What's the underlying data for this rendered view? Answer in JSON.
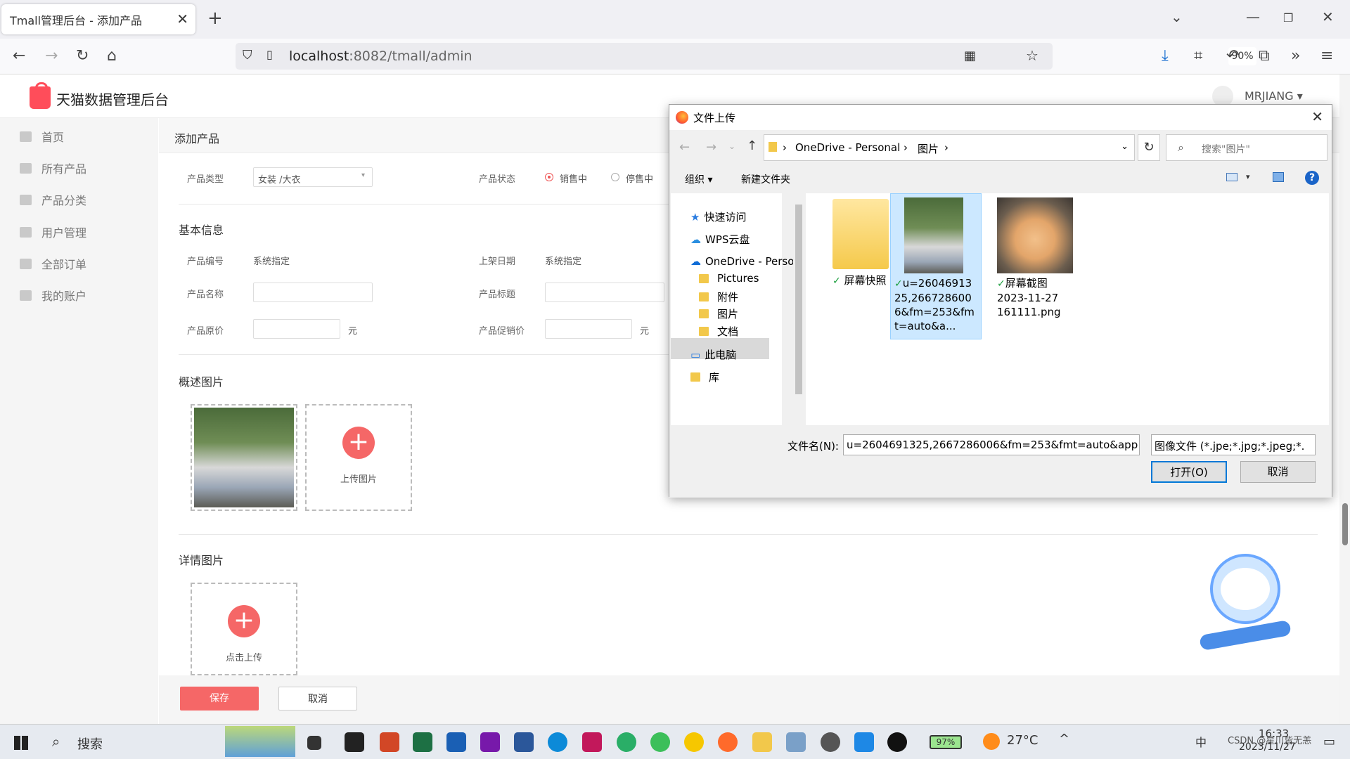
{
  "browser": {
    "tab_title": "Tmall管理后台 - 添加产品",
    "url_host": "localhost",
    "url_rest": ":8082/tmall/admin",
    "zoom": "90%"
  },
  "app": {
    "title": "天猫数据管理后台",
    "user": "MRJIANG ▾",
    "sidebar": [
      "首页",
      "所有产品",
      "产品分类",
      "用户管理",
      "全部订单",
      "我的账户"
    ],
    "page_title": "添加产品",
    "form": {
      "type_label": "产品类型",
      "type_value": "女装 /大衣",
      "status_label": "产品状态",
      "status_on": "销售中",
      "status_off": "停售中",
      "basic_info": "基本信息",
      "code_label": "产品编号",
      "code_value": "系统指定",
      "date_label": "上架日期",
      "date_value": "系统指定",
      "name_label": "产品名称",
      "subtitle_label": "产品标题",
      "price_label": "产品原价",
      "promo_label": "产品促销价",
      "unit": "元",
      "overview_images": "概述图片",
      "upload_image": "上传图片",
      "detail_images": "详情图片",
      "click_upload": "点击上传",
      "save": "保存",
      "cancel": "取消"
    }
  },
  "dialog": {
    "title": "文件上传",
    "path": [
      "OneDrive - Personal",
      "图片"
    ],
    "search_placeholder": "搜索\"图片\"",
    "organize": "组织 ▾",
    "new_folder": "新建文件夹",
    "nav": [
      "快速访问",
      "WPS云盘",
      "OneDrive - Perso",
      "Pictures",
      "附件",
      "图片",
      "文档",
      "此电脑",
      "库"
    ],
    "files": [
      {
        "name": "屏幕快照"
      },
      {
        "name": "u=2604691325,2667286006&fm=253&fmt=auto&a..."
      },
      {
        "name": "屏幕截图 2023-11-27 161111.png"
      }
    ],
    "filename_label": "文件名(N):",
    "filename_value": "u=2604691325,2667286006&fm=253&fmt=auto&app",
    "filetype": "图像文件 (*.jpe;*.jpg;*.jpeg;*.",
    "open": "打开(O)",
    "cancel": "取消"
  },
  "taskbar": {
    "search": "搜索",
    "battery": "97%",
    "temp": "27°C",
    "time": "16:33",
    "date": "2023/11/27",
    "ime": "中",
    "watermark": "CSDN @星川皆无恙"
  }
}
